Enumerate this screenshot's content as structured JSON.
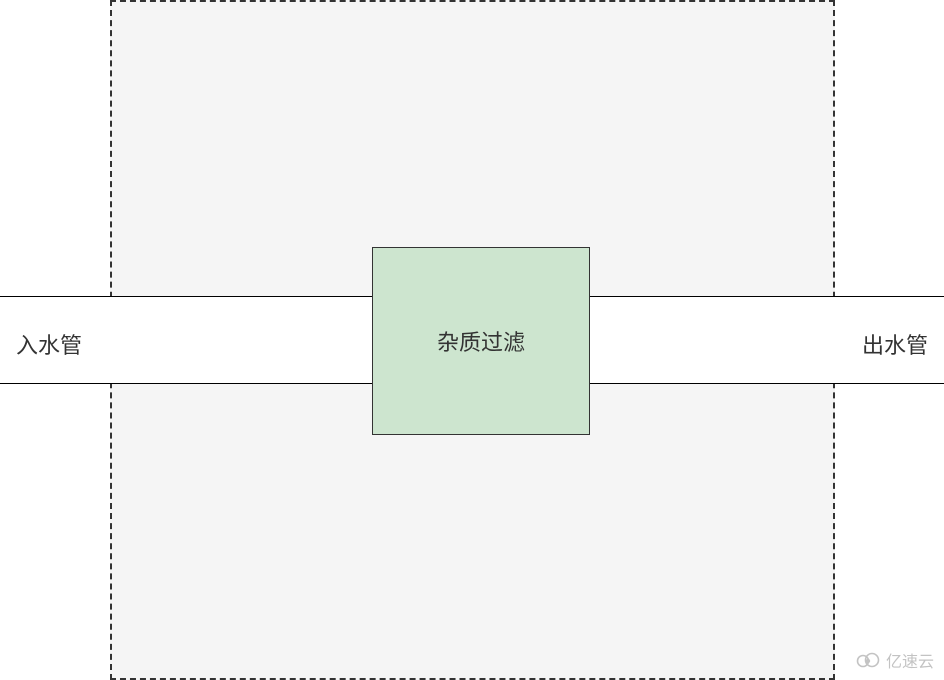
{
  "diagram": {
    "inlet_label": "入水管",
    "outlet_label": "出水管",
    "filter_label": "杂质过滤"
  },
  "watermark": {
    "text": "亿速云"
  },
  "colors": {
    "container_bg": "#f5f5f5",
    "filter_bg": "#cde5cf",
    "border": "#333333"
  }
}
